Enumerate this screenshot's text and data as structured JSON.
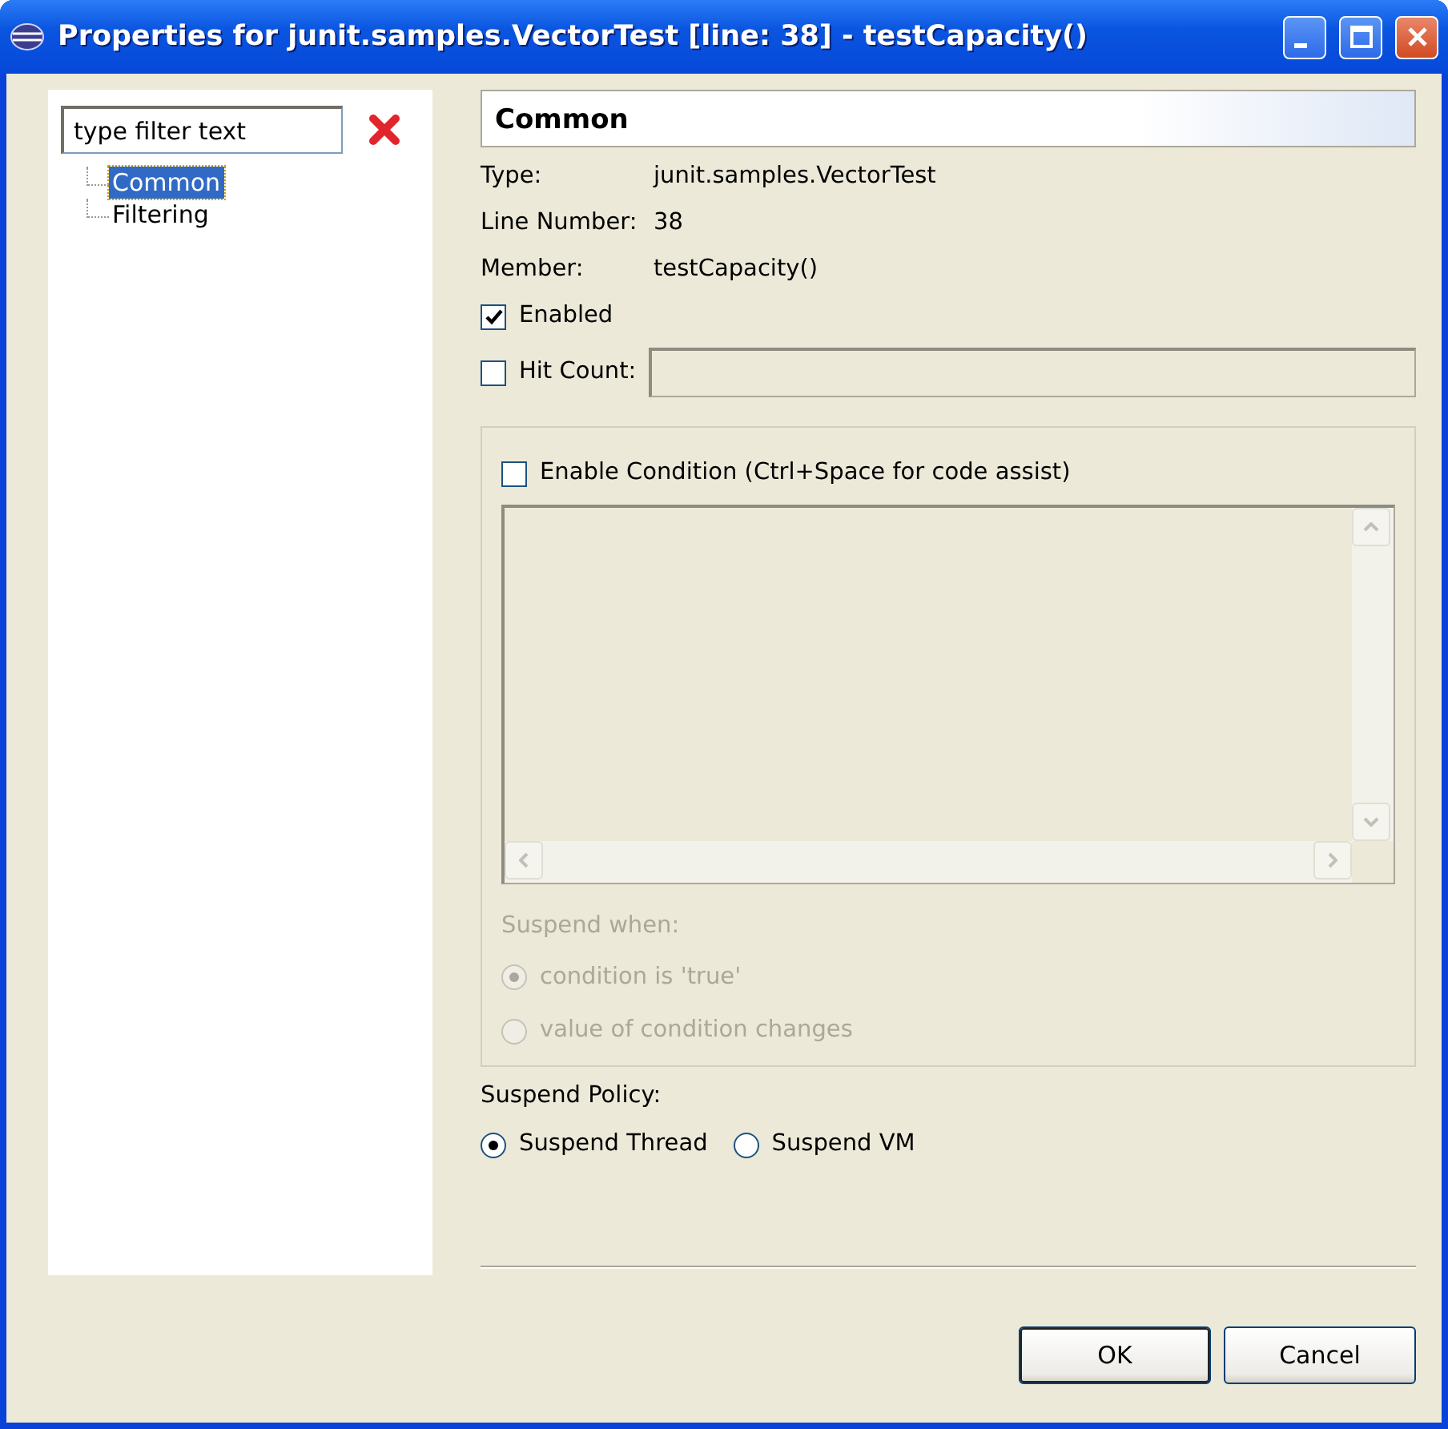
{
  "window": {
    "title": "Properties for junit.samples.VectorTest [line: 38] - testCapacity()"
  },
  "filter": {
    "value": "type filter text"
  },
  "tree": [
    {
      "label": "Common",
      "selected": true
    },
    {
      "label": "Filtering",
      "selected": false
    }
  ],
  "page": {
    "title": "Common",
    "properties": [
      {
        "label": "Type:",
        "value": "junit.samples.VectorTest"
      },
      {
        "label": "Line Number:",
        "value": "38"
      },
      {
        "label": "Member:",
        "value": "testCapacity()"
      }
    ],
    "enabled": {
      "label": "Enabled",
      "checked": true
    },
    "hit_count": {
      "label": "Hit Count:",
      "checked": false,
      "disabled": true
    },
    "condition": {
      "label": "Enable Condition (Ctrl+Space for code assist)",
      "checked": false,
      "disabled": true
    },
    "suspend_when": {
      "label": "Suspend when:",
      "disabled": true,
      "options": [
        {
          "label": "condition is 'true'",
          "selected": true
        },
        {
          "label": "value of condition changes",
          "selected": false
        }
      ]
    },
    "suspend_policy": {
      "label": "Suspend Policy:",
      "options": [
        {
          "label": "Suspend Thread",
          "selected": true
        },
        {
          "label": "Suspend VM",
          "selected": false
        }
      ]
    }
  },
  "buttons": [
    {
      "label": "OK",
      "default": true
    },
    {
      "label": "Cancel",
      "default": false
    }
  ]
}
